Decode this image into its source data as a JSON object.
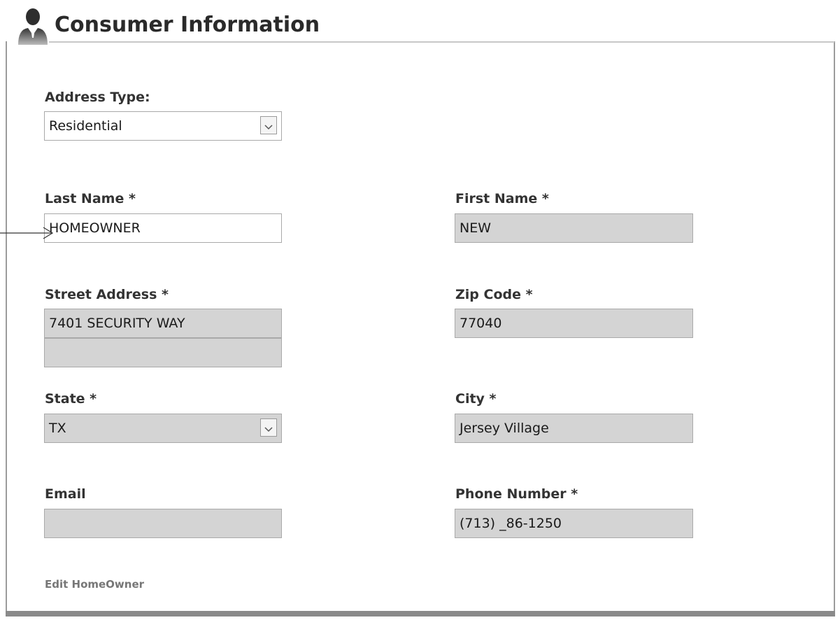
{
  "header": {
    "title": "Consumer Information",
    "icon": "person-icon"
  },
  "address_type": {
    "label": "Address Type:",
    "value": "Residential"
  },
  "last_name": {
    "label": "Last Name *",
    "value": "HOMEOWNER"
  },
  "first_name": {
    "label": "First Name *",
    "value": "NEW"
  },
  "street_address": {
    "label": "Street Address *",
    "line1": "7401 SECURITY WAY",
    "line2": ""
  },
  "zip_code": {
    "label": "Zip Code *",
    "value": "77040"
  },
  "state": {
    "label": "State *",
    "value": "TX"
  },
  "city": {
    "label": "City *",
    "value": "Jersey Village"
  },
  "email": {
    "label": "Email",
    "value": ""
  },
  "phone": {
    "label": "Phone Number *",
    "value": "(713) _86-1250"
  },
  "edit_link": {
    "label": "Edit HomeOwner"
  },
  "colors": {
    "disabled_field": "#d4d4d4",
    "border": "#a9a9a9",
    "text": "#333333"
  }
}
